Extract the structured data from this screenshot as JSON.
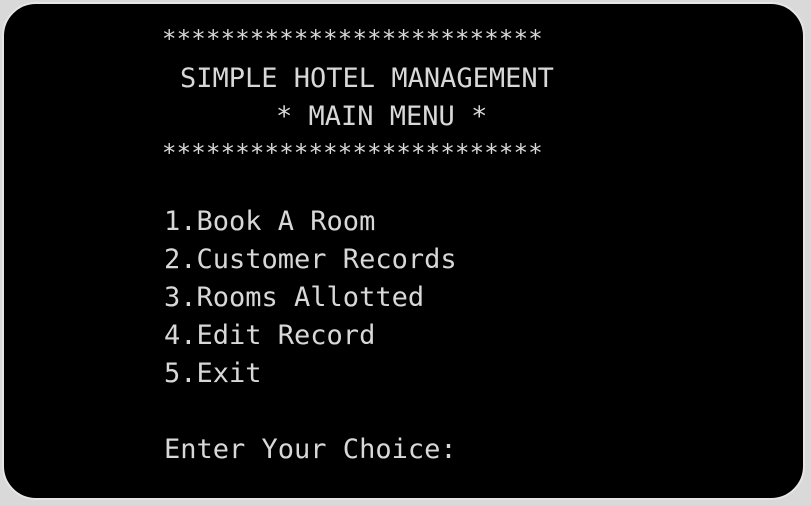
{
  "banner": {
    "border": "**************************",
    "title": "SIMPLE HOTEL MANAGEMENT",
    "subtitle": "* MAIN MENU *"
  },
  "menu": {
    "items": [
      {
        "label": "1.Book A Room"
      },
      {
        "label": "2.Customer Records"
      },
      {
        "label": "3.Rooms Allotted"
      },
      {
        "label": "4.Edit Record"
      },
      {
        "label": "5.Exit"
      }
    ]
  },
  "prompt": {
    "text": "Enter Your Choice:",
    "input_value": ""
  },
  "colors": {
    "background": "#000000",
    "text": "#d8d8d8",
    "frame": "#e6e6e6"
  }
}
